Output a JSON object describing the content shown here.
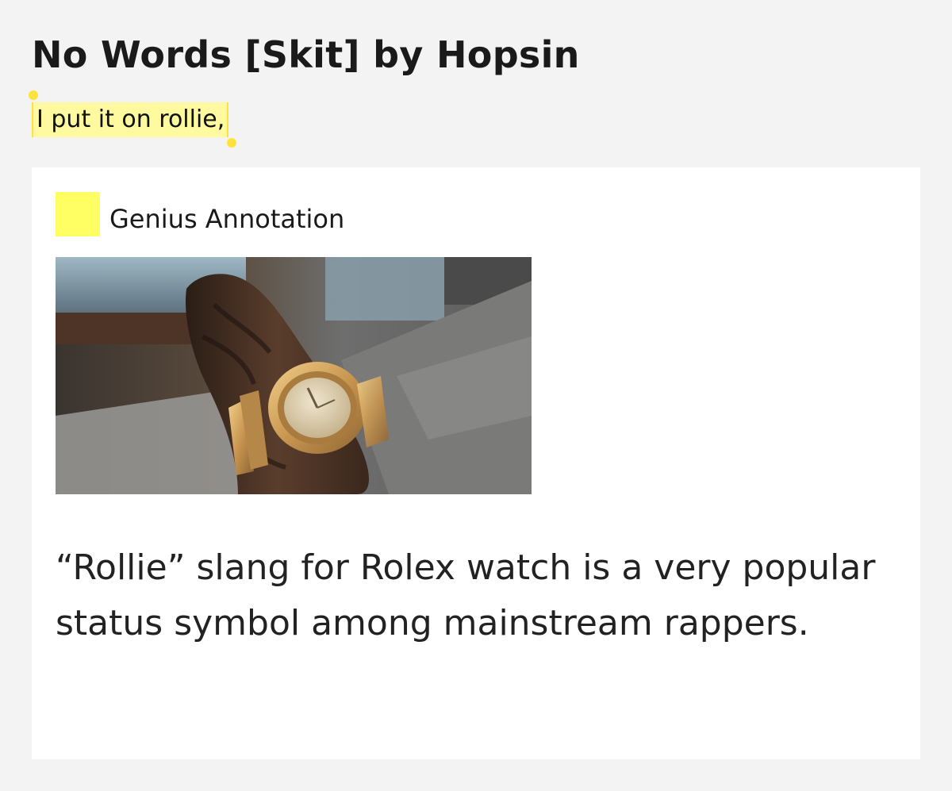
{
  "song": {
    "title": "No Words [Skit] by Hopsin"
  },
  "lyric": {
    "line": "I put it on rollie,"
  },
  "annotation": {
    "label": "Genius Annotation",
    "image": {
      "subject": "wrist-with-gold-watch"
    },
    "body": "“Rollie” slang for Rolex watch is a very popular status symbol among mainstream rappers."
  },
  "colors": {
    "page_background": "#f3f3f3",
    "card_background": "#ffffff",
    "lyric_highlight": "#fffaa0",
    "highlight_handles": "#ffe33a",
    "annotation_swatch": "#ffff64",
    "text": "#222222"
  }
}
